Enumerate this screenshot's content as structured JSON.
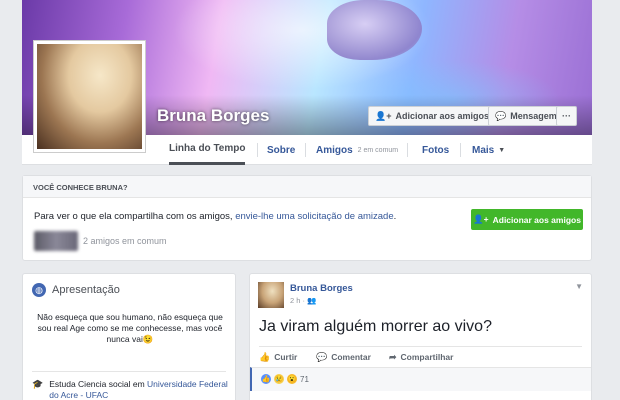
{
  "profile": {
    "name": "Bruna Borges",
    "add_friend_label": "Adicionar aos amigos",
    "message_label": "Mensagem",
    "more_label": "···"
  },
  "nav": {
    "tabs": [
      {
        "label": "Linha do Tempo"
      },
      {
        "label": "Sobre"
      },
      {
        "label": "Amigos",
        "sub": "2 em comum"
      },
      {
        "label": "Fotos"
      },
      {
        "label": "Mais"
      }
    ]
  },
  "know": {
    "heading": "VOCÊ CONHECE BRUNA?",
    "text_before": "Para ver o que ela compartilha com os amigos, ",
    "text_link": "envie-lhe uma solicitação de amizade",
    "text_after": ".",
    "button_label": "Adicionar aos amigos",
    "mutual": "2 amigos em comum"
  },
  "intro": {
    "title": "Apresentação",
    "bio": "Não esqueça que sou humano, não esqueça que sou real Age como se me conhecesse, mas você nunca vai😉",
    "study_prefix": "Estuda Ciencia social em ",
    "study_link": "Universidade Federal do Acre - UFAC"
  },
  "post": {
    "author": "Bruna Borges",
    "time": "2 h",
    "audience_icon": "people-icon",
    "text": "Ja viram alguém morrer ao vivo?",
    "actions": {
      "like": "Curtir",
      "comment": "Comentar",
      "share": "Compartilhar"
    },
    "reaction_count": "71"
  },
  "colors": {
    "link": "#365899",
    "green": "#42b72a",
    "background": "#e9ebee"
  }
}
